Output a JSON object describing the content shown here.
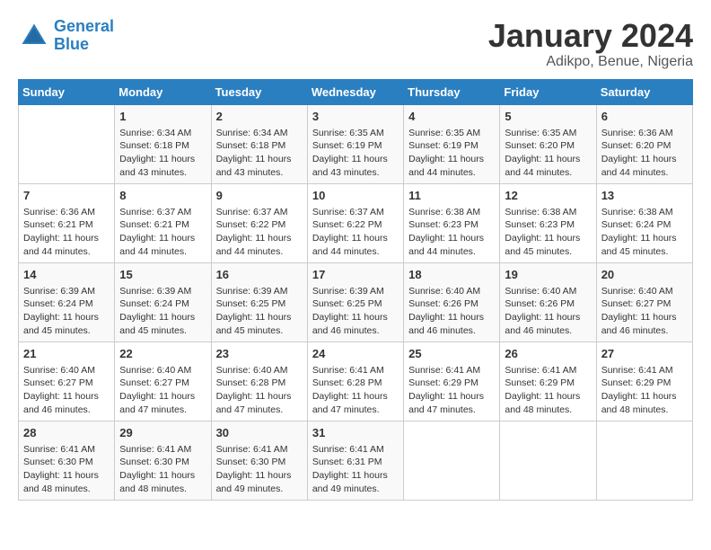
{
  "header": {
    "logo_line1": "General",
    "logo_line2": "Blue",
    "month": "January 2024",
    "location": "Adikpo, Benue, Nigeria"
  },
  "weekdays": [
    "Sunday",
    "Monday",
    "Tuesday",
    "Wednesday",
    "Thursday",
    "Friday",
    "Saturday"
  ],
  "weeks": [
    [
      {
        "day": "",
        "info": ""
      },
      {
        "day": "1",
        "info": "Sunrise: 6:34 AM\nSunset: 6:18 PM\nDaylight: 11 hours\nand 43 minutes."
      },
      {
        "day": "2",
        "info": "Sunrise: 6:34 AM\nSunset: 6:18 PM\nDaylight: 11 hours\nand 43 minutes."
      },
      {
        "day": "3",
        "info": "Sunrise: 6:35 AM\nSunset: 6:19 PM\nDaylight: 11 hours\nand 43 minutes."
      },
      {
        "day": "4",
        "info": "Sunrise: 6:35 AM\nSunset: 6:19 PM\nDaylight: 11 hours\nand 44 minutes."
      },
      {
        "day": "5",
        "info": "Sunrise: 6:35 AM\nSunset: 6:20 PM\nDaylight: 11 hours\nand 44 minutes."
      },
      {
        "day": "6",
        "info": "Sunrise: 6:36 AM\nSunset: 6:20 PM\nDaylight: 11 hours\nand 44 minutes."
      }
    ],
    [
      {
        "day": "7",
        "info": "Sunrise: 6:36 AM\nSunset: 6:21 PM\nDaylight: 11 hours\nand 44 minutes."
      },
      {
        "day": "8",
        "info": "Sunrise: 6:37 AM\nSunset: 6:21 PM\nDaylight: 11 hours\nand 44 minutes."
      },
      {
        "day": "9",
        "info": "Sunrise: 6:37 AM\nSunset: 6:22 PM\nDaylight: 11 hours\nand 44 minutes."
      },
      {
        "day": "10",
        "info": "Sunrise: 6:37 AM\nSunset: 6:22 PM\nDaylight: 11 hours\nand 44 minutes."
      },
      {
        "day": "11",
        "info": "Sunrise: 6:38 AM\nSunset: 6:23 PM\nDaylight: 11 hours\nand 44 minutes."
      },
      {
        "day": "12",
        "info": "Sunrise: 6:38 AM\nSunset: 6:23 PM\nDaylight: 11 hours\nand 45 minutes."
      },
      {
        "day": "13",
        "info": "Sunrise: 6:38 AM\nSunset: 6:24 PM\nDaylight: 11 hours\nand 45 minutes."
      }
    ],
    [
      {
        "day": "14",
        "info": "Sunrise: 6:39 AM\nSunset: 6:24 PM\nDaylight: 11 hours\nand 45 minutes."
      },
      {
        "day": "15",
        "info": "Sunrise: 6:39 AM\nSunset: 6:24 PM\nDaylight: 11 hours\nand 45 minutes."
      },
      {
        "day": "16",
        "info": "Sunrise: 6:39 AM\nSunset: 6:25 PM\nDaylight: 11 hours\nand 45 minutes."
      },
      {
        "day": "17",
        "info": "Sunrise: 6:39 AM\nSunset: 6:25 PM\nDaylight: 11 hours\nand 46 minutes."
      },
      {
        "day": "18",
        "info": "Sunrise: 6:40 AM\nSunset: 6:26 PM\nDaylight: 11 hours\nand 46 minutes."
      },
      {
        "day": "19",
        "info": "Sunrise: 6:40 AM\nSunset: 6:26 PM\nDaylight: 11 hours\nand 46 minutes."
      },
      {
        "day": "20",
        "info": "Sunrise: 6:40 AM\nSunset: 6:27 PM\nDaylight: 11 hours\nand 46 minutes."
      }
    ],
    [
      {
        "day": "21",
        "info": "Sunrise: 6:40 AM\nSunset: 6:27 PM\nDaylight: 11 hours\nand 46 minutes."
      },
      {
        "day": "22",
        "info": "Sunrise: 6:40 AM\nSunset: 6:27 PM\nDaylight: 11 hours\nand 47 minutes."
      },
      {
        "day": "23",
        "info": "Sunrise: 6:40 AM\nSunset: 6:28 PM\nDaylight: 11 hours\nand 47 minutes."
      },
      {
        "day": "24",
        "info": "Sunrise: 6:41 AM\nSunset: 6:28 PM\nDaylight: 11 hours\nand 47 minutes."
      },
      {
        "day": "25",
        "info": "Sunrise: 6:41 AM\nSunset: 6:29 PM\nDaylight: 11 hours\nand 47 minutes."
      },
      {
        "day": "26",
        "info": "Sunrise: 6:41 AM\nSunset: 6:29 PM\nDaylight: 11 hours\nand 48 minutes."
      },
      {
        "day": "27",
        "info": "Sunrise: 6:41 AM\nSunset: 6:29 PM\nDaylight: 11 hours\nand 48 minutes."
      }
    ],
    [
      {
        "day": "28",
        "info": "Sunrise: 6:41 AM\nSunset: 6:30 PM\nDaylight: 11 hours\nand 48 minutes."
      },
      {
        "day": "29",
        "info": "Sunrise: 6:41 AM\nSunset: 6:30 PM\nDaylight: 11 hours\nand 48 minutes."
      },
      {
        "day": "30",
        "info": "Sunrise: 6:41 AM\nSunset: 6:30 PM\nDaylight: 11 hours\nand 49 minutes."
      },
      {
        "day": "31",
        "info": "Sunrise: 6:41 AM\nSunset: 6:31 PM\nDaylight: 11 hours\nand 49 minutes."
      },
      {
        "day": "",
        "info": ""
      },
      {
        "day": "",
        "info": ""
      },
      {
        "day": "",
        "info": ""
      }
    ]
  ]
}
